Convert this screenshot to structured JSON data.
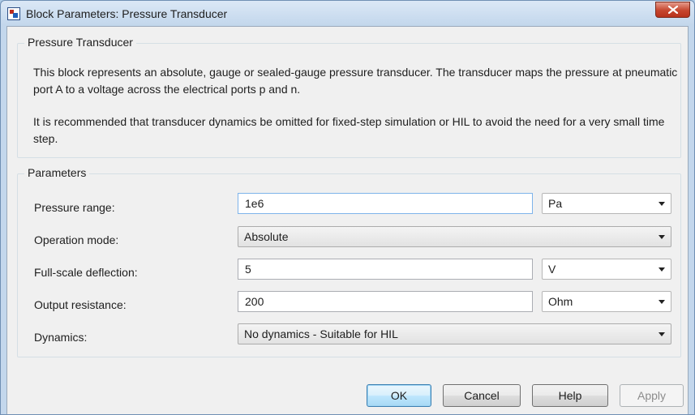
{
  "window": {
    "title": "Block Parameters: Pressure Transducer"
  },
  "description_group": {
    "legend": "Pressure Transducer",
    "paragraph1": "This block represents an absolute, gauge or sealed-gauge pressure transducer. The transducer maps the pressure at pneumatic port A to a voltage across the electrical ports p and n.",
    "paragraph2": "It is recommended that transducer dynamics be omitted for fixed-step simulation or HIL to avoid the need for a very small time step."
  },
  "parameters": {
    "legend": "Parameters",
    "pressure_range": {
      "label": "Pressure range:",
      "value": "1e6",
      "unit": "Pa"
    },
    "operation_mode": {
      "label": "Operation mode:",
      "value": "Absolute"
    },
    "full_scale": {
      "label": "Full-scale deflection:",
      "value": "5",
      "unit": "V"
    },
    "output_resistance": {
      "label": "Output resistance:",
      "value": "200",
      "unit": "Ohm"
    },
    "dynamics": {
      "label": "Dynamics:",
      "value": "No dynamics - Suitable for HIL"
    }
  },
  "buttons": {
    "ok": "OK",
    "cancel": "Cancel",
    "help": "Help",
    "apply": "Apply"
  },
  "icons": {
    "app": "block-icon",
    "close": "close-icon"
  },
  "colors": {
    "close_button": "#c6462e",
    "focus_border": "#7eb4ea",
    "default_button": "#3c7fb1"
  }
}
